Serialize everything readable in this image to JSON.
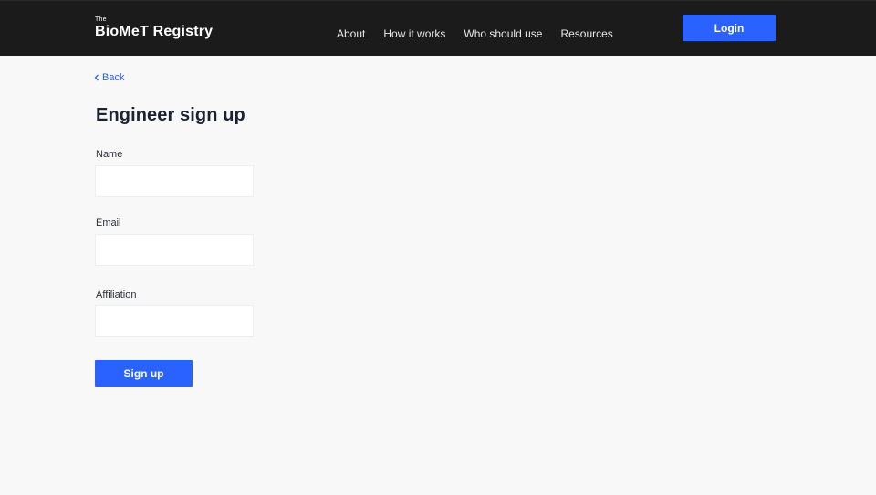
{
  "header": {
    "brand_prefix": "The",
    "brand_name": "BioMeT Registry",
    "nav": [
      "About",
      "How it works",
      "Who should use",
      "Resources"
    ],
    "login_label": "Login"
  },
  "main": {
    "back_label": "Back",
    "title": "Engineer sign up",
    "fields": {
      "name": {
        "label": "Name",
        "value": "",
        "placeholder": ""
      },
      "email": {
        "label": "Email",
        "value": "",
        "placeholder": ""
      },
      "affiliation": {
        "label": "Affiliation",
        "value": "",
        "placeholder": ""
      }
    },
    "submit_label": "Sign up"
  },
  "colors": {
    "accent": "#2962ff",
    "navbar": "#1b1b1b",
    "background": "#f8f8f8"
  },
  "icons": {
    "back": "chevron-left-icon"
  }
}
